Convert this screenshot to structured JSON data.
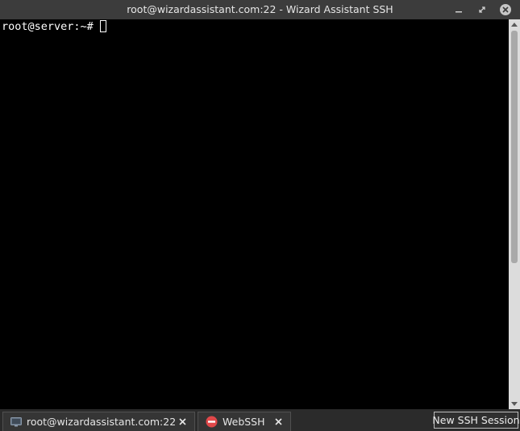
{
  "window": {
    "title": "root@wizardassistant.com:22 - Wizard Assistant SSH"
  },
  "terminal": {
    "prompt": "root@server:~#",
    "cursor_style": "block-outline"
  },
  "tabs": [
    {
      "label": "root@wizardassistant.com:22",
      "icon": "monitor-icon"
    },
    {
      "label": "WebSSH",
      "icon": "no-entry-icon"
    }
  ],
  "actions": {
    "new_session_label": "New SSH Session"
  },
  "colors": {
    "terminal_bg": "#000000",
    "terminal_fg": "#ffffff",
    "titlebar_bg": "#3c3c3c",
    "tab_error_icon": "#e0484a"
  }
}
